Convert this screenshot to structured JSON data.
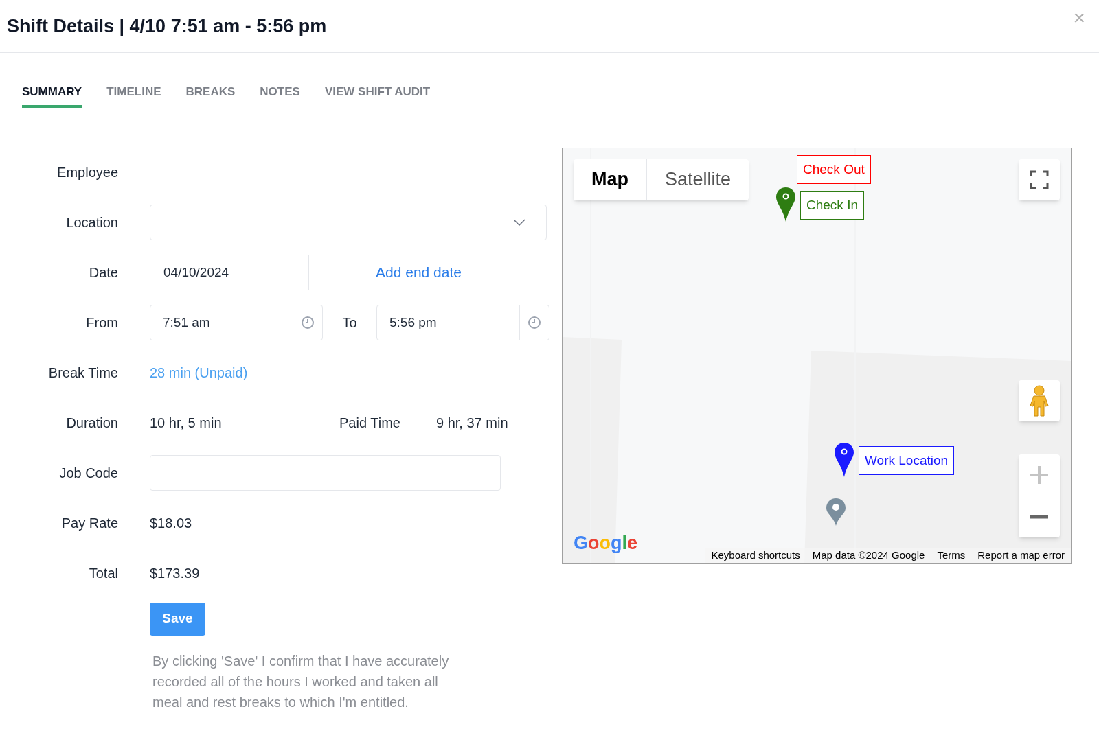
{
  "dialog": {
    "title": "Shift Details | 4/10 7:51 am - 5:56 pm",
    "close": "×"
  },
  "tabs": [
    {
      "label": "SUMMARY",
      "selected": true
    },
    {
      "label": "TIMELINE",
      "selected": false
    },
    {
      "label": "BREAKS",
      "selected": false
    },
    {
      "label": "NOTES",
      "selected": false
    },
    {
      "label": "VIEW SHIFT AUDIT",
      "selected": false
    }
  ],
  "form": {
    "employee": {
      "label": "Employee"
    },
    "location": {
      "label": "Location"
    },
    "date": {
      "label": "Date",
      "value": "04/10/2024",
      "add_end_date": "Add end date"
    },
    "from": {
      "label": "From",
      "value": "7:51 am"
    },
    "to": {
      "label": "To",
      "value": "5:56 pm"
    },
    "break_time": {
      "label": "Break Time",
      "value": "28 min (Unpaid)"
    },
    "duration": {
      "label": "Duration",
      "value": "10 hr, 5 min"
    },
    "paid_time": {
      "label": "Paid Time",
      "value": "9 hr, 37 min"
    },
    "job_code": {
      "label": "Job Code"
    },
    "pay_rate": {
      "label": "Pay Rate",
      "value": "$18.03"
    },
    "total": {
      "label": "Total",
      "value": "$173.39"
    },
    "save": "Save",
    "disclaimer": "By clicking 'Save' I confirm that I have accurately recorded all of the hours I worked and taken all meal and rest breaks to which I'm entitled."
  },
  "map": {
    "map_types": [
      {
        "label": "Map",
        "selected": true
      },
      {
        "label": "Satellite",
        "selected": false
      }
    ],
    "markers": [
      {
        "label": "Check Out",
        "color": "#ff0000",
        "kind": "label"
      },
      {
        "label": "Check In",
        "color": "#2e7d12",
        "kind": "pin"
      },
      {
        "label": "Work Location",
        "color": "#1a1aff",
        "kind": "pin"
      }
    ],
    "logo": "Google",
    "footer": [
      "Keyboard shortcuts",
      "Map data ©2024 Google",
      "Terms",
      "Report a map error"
    ]
  }
}
